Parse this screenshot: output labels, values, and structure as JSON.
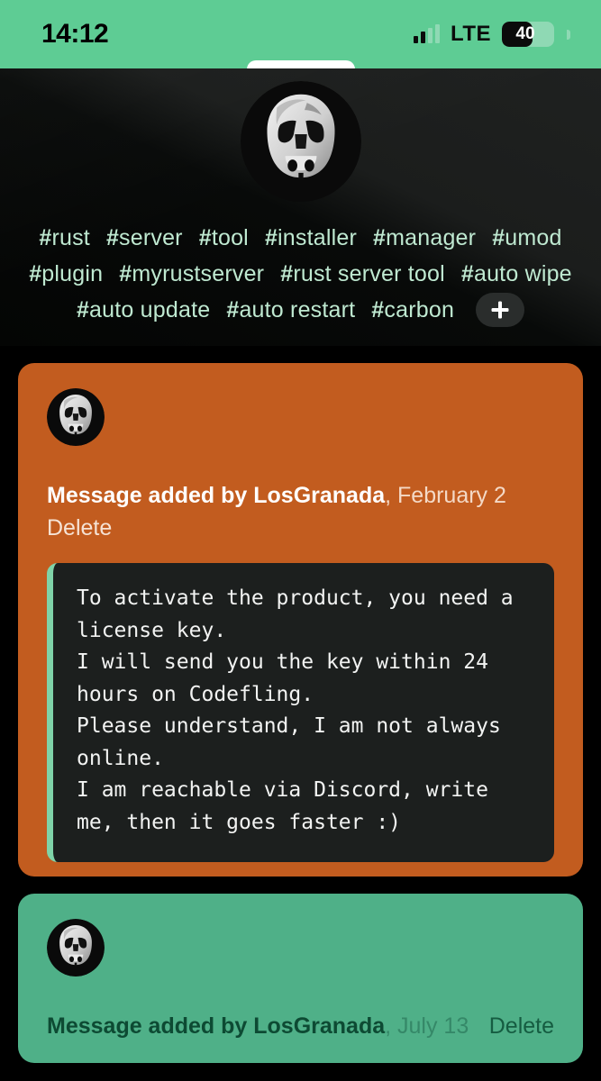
{
  "status_bar": {
    "time": "14:12",
    "network_label": "LTE",
    "battery_percent": "40",
    "signal_icon": "signal-bars-icon",
    "battery_icon": "battery-icon"
  },
  "header": {
    "avatar_icon": "stormtrooper-avatar",
    "tags": [
      "#rust",
      "#server",
      "#tool",
      "#installer",
      "#manager",
      "#umod",
      "#plugin",
      "#myrustserver",
      "#rust server tool",
      "#auto wipe",
      "#auto update",
      "#auto restart",
      "#carbon"
    ],
    "add_tag_label": "+",
    "add_tag_icon": "plus-icon"
  },
  "messages": [
    {
      "avatar_icon": "stormtrooper-avatar",
      "prefix": "Message added by ",
      "author": "LosGranada",
      "date": ", February 2",
      "delete_label": "Delete",
      "code": "To activate the product, you need a license key.\nI will send you the key within 24 hours on Codefling.\nPlease understand, I am not always online.\nI am reachable via Discord, write me, then it goes faster :)"
    },
    {
      "avatar_icon": "stormtrooper-avatar",
      "prefix": "Message added by ",
      "author": "LosGranada",
      "date": ", July 13",
      "delete_label": "Delete"
    }
  ],
  "colors": {
    "status_bar_green": "#5ECC94",
    "card_orange": "#C25C1F",
    "card_green": "#4FB088",
    "code_background": "#1C1F1E",
    "code_accent": "#7FD3A8",
    "tag_text": "#BFE9D1",
    "page_background": "#000000"
  }
}
